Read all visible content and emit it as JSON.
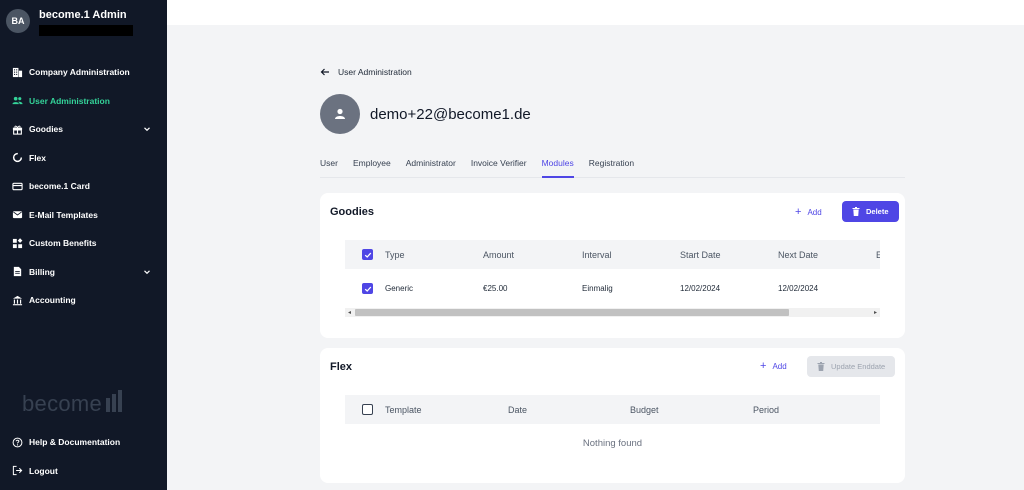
{
  "sidebar": {
    "user_initials": "BA",
    "user_name": "become.1 Admin",
    "items": [
      {
        "label": "Company Administration",
        "icon": "building-icon",
        "active": false
      },
      {
        "label": "User Administration",
        "icon": "users-icon",
        "active": true
      },
      {
        "label": "Goodies",
        "icon": "gift-icon",
        "active": false,
        "expandable": true
      },
      {
        "label": "Flex",
        "icon": "spinner-icon",
        "active": false
      },
      {
        "label": "become.1 Card",
        "icon": "credit-card-icon",
        "active": false
      },
      {
        "label": "E-Mail Templates",
        "icon": "envelope-icon",
        "active": false
      },
      {
        "label": "Custom Benefits",
        "icon": "widgets-icon",
        "active": false
      },
      {
        "label": "Billing",
        "icon": "document-icon",
        "active": false,
        "expandable": true
      },
      {
        "label": "Accounting",
        "icon": "bank-icon",
        "active": false
      }
    ],
    "logo_text": "become",
    "bottom_items": [
      {
        "label": "Help & Documentation",
        "icon": "help-circle-icon"
      },
      {
        "label": "Logout",
        "icon": "logout-icon"
      }
    ]
  },
  "main": {
    "back_label": "User Administration",
    "email": "demo+22@become1.de",
    "tabs": [
      {
        "label": "User",
        "active": false
      },
      {
        "label": "Employee",
        "active": false
      },
      {
        "label": "Administrator",
        "active": false
      },
      {
        "label": "Invoice Verifier",
        "active": false
      },
      {
        "label": "Modules",
        "active": true
      },
      {
        "label": "Registration",
        "active": false
      }
    ],
    "goodies": {
      "title": "Goodies",
      "add_label": "Add",
      "delete_label": "Delete",
      "columns": [
        "Type",
        "Amount",
        "Interval",
        "Start Date",
        "Next Date",
        "E"
      ],
      "rows": [
        {
          "type": "Generic",
          "amount": "€25.00",
          "interval": "Einmalig",
          "start": "12/02/2024",
          "next": "12/02/2024",
          "checked": true
        }
      ],
      "header_checked": true
    },
    "flex": {
      "title": "Flex",
      "add_label": "Add",
      "update_label": "Update Enddate",
      "columns": [
        "Template",
        "Date",
        "Budget",
        "Period"
      ],
      "empty_text": "Nothing found"
    }
  },
  "colors": {
    "sidebar_bg": "#111827",
    "accent": "#4f46e5",
    "active_nav": "#34d399"
  }
}
